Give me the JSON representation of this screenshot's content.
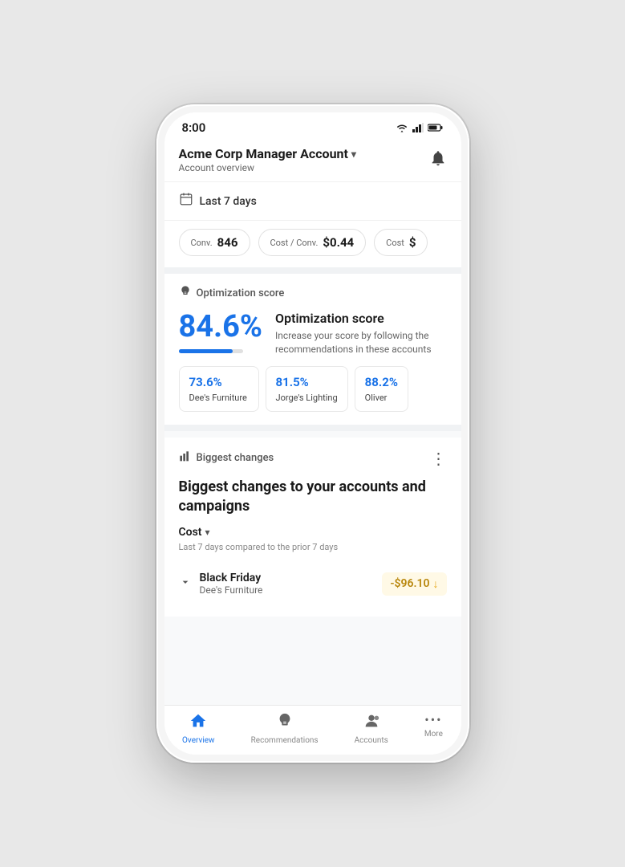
{
  "status_bar": {
    "time": "8:00"
  },
  "header": {
    "account_name": "Acme Corp Manager Account",
    "dropdown_arrow": "▾",
    "subtitle": "Account overview",
    "bell_icon": "🔔"
  },
  "date_section": {
    "label": "Last 7 days"
  },
  "metrics": [
    {
      "label": "Conv.",
      "value": "846"
    },
    {
      "label": "Cost / Conv.",
      "value": "$0.44"
    },
    {
      "label": "Cost",
      "value": "$"
    }
  ],
  "optimization": {
    "section_label": "Optimization score",
    "score": "84.6%",
    "bar_fill_pct": 84.6,
    "bar_total_width": 80,
    "title": "Optimization score",
    "description": "Increase your score by following the recommendations in these accounts",
    "accounts": [
      {
        "score": "73.6%",
        "name": "Dee's Furniture"
      },
      {
        "score": "81.5%",
        "name": "Jorge's Lighting"
      },
      {
        "score": "88.2%",
        "name": "Oliver"
      }
    ]
  },
  "biggest_changes": {
    "section_label": "Biggest changes",
    "main_title": "Biggest changes to your accounts and campaigns",
    "cost_label": "Cost",
    "date_compare": "Last 7 days compared to the prior 7 days",
    "items": [
      {
        "name": "Black Friday",
        "sub": "Dee's Furniture",
        "value": "-$96.10",
        "arrow": "↓"
      }
    ]
  },
  "bottom_nav": [
    {
      "label": "Overview",
      "active": true,
      "icon": "🏠"
    },
    {
      "label": "Recommendations",
      "active": false,
      "icon": "💡"
    },
    {
      "label": "Accounts",
      "active": false,
      "icon": "👤"
    },
    {
      "label": "More",
      "active": false,
      "icon": "···"
    }
  ]
}
